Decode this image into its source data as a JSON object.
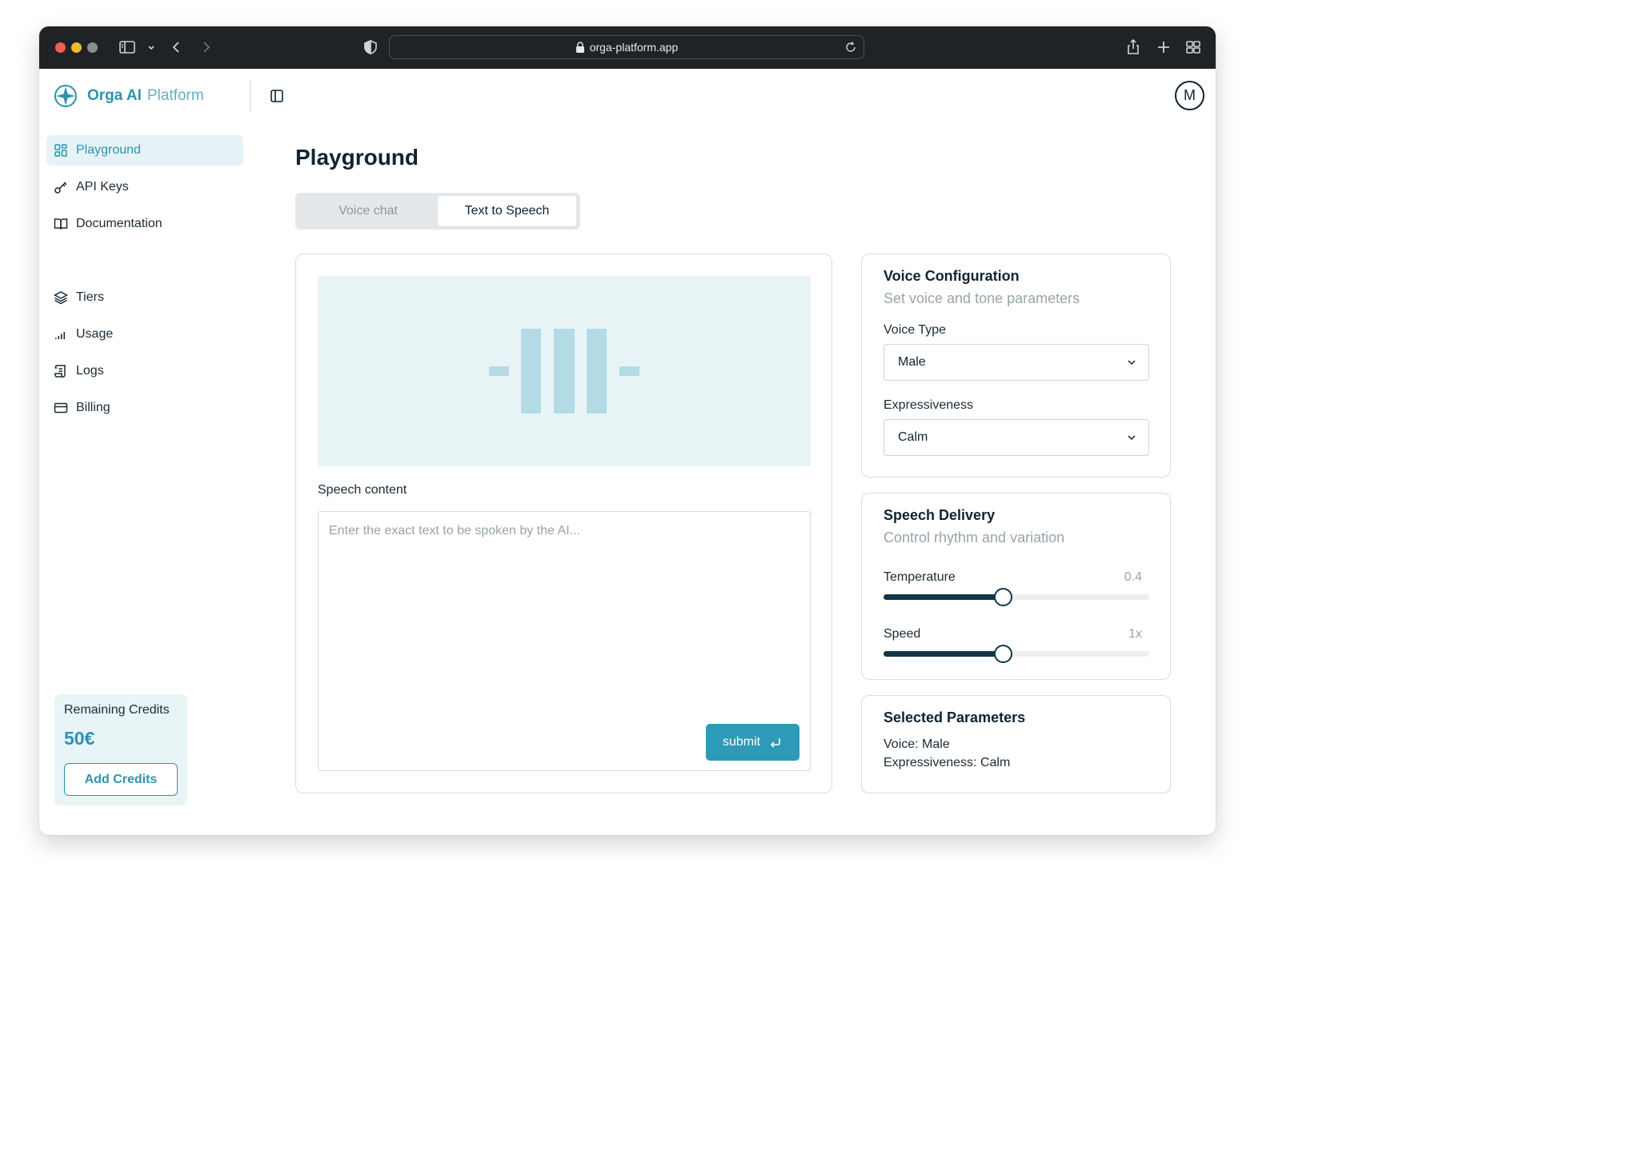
{
  "browser": {
    "url": "orga-platform.app"
  },
  "brand": {
    "name": "Orga AI",
    "sub": "Platform"
  },
  "user": {
    "avatar_initial": "M"
  },
  "sidebar": {
    "items": [
      {
        "label": "Playground",
        "icon": "grid-icon",
        "active": true
      },
      {
        "label": "API Keys",
        "icon": "key-icon",
        "active": false
      },
      {
        "label": "Documentation",
        "icon": "book-icon",
        "active": false
      },
      {
        "label": "Tiers",
        "icon": "layers-icon",
        "active": false
      },
      {
        "label": "Usage",
        "icon": "bar-signal-icon",
        "active": false
      },
      {
        "label": "Logs",
        "icon": "scroll-icon",
        "active": false
      },
      {
        "label": "Billing",
        "icon": "credit-card-icon",
        "active": false
      }
    ],
    "credits": {
      "label": "Remaining Credits",
      "amount": "50€",
      "button": "Add Credits"
    }
  },
  "main": {
    "title": "Playground",
    "tabs": [
      {
        "label": "Voice chat",
        "active": false
      },
      {
        "label": "Text to Speech",
        "active": true
      }
    ],
    "speech_label": "Speech content",
    "speech_placeholder": "Enter the exact text to be spoken by the AI...",
    "submit_label": "submit"
  },
  "voice_config": {
    "title": "Voice Configuration",
    "subtitle": "Set voice and tone parameters",
    "voice_type_label": "Voice Type",
    "voice_type_value": "Male",
    "expressiveness_label": "Expressiveness",
    "expressiveness_value": "Calm"
  },
  "speech_delivery": {
    "title": "Speech Delivery",
    "subtitle": "Control rhythm and variation",
    "temperature_label": "Temperature",
    "temperature_value": "0.4",
    "temperature_level": 0.45,
    "speed_label": "Speed",
    "speed_value": "1x",
    "speed_level": 0.45
  },
  "selected_params": {
    "title": "Selected Parameters",
    "voice_line": "Voice: Male",
    "expressiveness_line": "Expressiveness: Calm"
  },
  "colors": {
    "accent": "#2d93ad",
    "dark": "#0f2433",
    "light_bg": "#e9f4f7",
    "wave": "#b2dbe5",
    "slider": "#123648"
  }
}
